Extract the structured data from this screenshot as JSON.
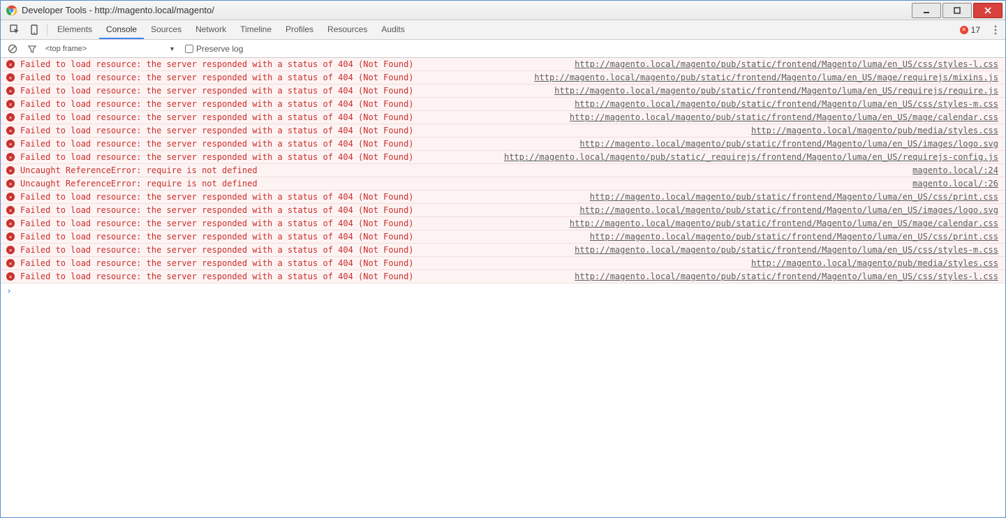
{
  "window": {
    "title": "Developer Tools - http://magento.local/magento/"
  },
  "tabs": {
    "items": [
      {
        "label": "Elements",
        "active": false
      },
      {
        "label": "Console",
        "active": true
      },
      {
        "label": "Sources",
        "active": false
      },
      {
        "label": "Network",
        "active": false
      },
      {
        "label": "Timeline",
        "active": false
      },
      {
        "label": "Profiles",
        "active": false
      },
      {
        "label": "Resources",
        "active": false
      },
      {
        "label": "Audits",
        "active": false
      }
    ],
    "error_count": "17"
  },
  "console_toolbar": {
    "frame_selector": "<top frame>",
    "preserve_log_label": "Preserve log",
    "preserve_log_checked": false
  },
  "messages": [
    {
      "text": "Failed to load resource: the server responded with a status of 404 (Not Found)",
      "link": "http://magento.local/magento/pub/static/frontend/Magento/luma/en_US/css/styles-l.css"
    },
    {
      "text": "Failed to load resource: the server responded with a status of 404 (Not Found)",
      "link": "http://magento.local/magento/pub/static/frontend/Magento/luma/en_US/mage/requirejs/mixins.js"
    },
    {
      "text": "Failed to load resource: the server responded with a status of 404 (Not Found)",
      "link": "http://magento.local/magento/pub/static/frontend/Magento/luma/en_US/requirejs/require.js"
    },
    {
      "text": "Failed to load resource: the server responded with a status of 404 (Not Found)",
      "link": "http://magento.local/magento/pub/static/frontend/Magento/luma/en_US/css/styles-m.css"
    },
    {
      "text": "Failed to load resource: the server responded with a status of 404 (Not Found)",
      "link": "http://magento.local/magento/pub/static/frontend/Magento/luma/en_US/mage/calendar.css"
    },
    {
      "text": "Failed to load resource: the server responded with a status of 404 (Not Found)",
      "link": "http://magento.local/magento/pub/media/styles.css"
    },
    {
      "text": "Failed to load resource: the server responded with a status of 404 (Not Found)",
      "link": "http://magento.local/magento/pub/static/frontend/Magento/luma/en_US/images/logo.svg"
    },
    {
      "text": "Failed to load resource: the server responded with a status of 404 (Not Found)",
      "link": "http://magento.local/magento/pub/static/_requirejs/frontend/Magento/luma/en_US/requirejs-config.js"
    },
    {
      "text": "Uncaught ReferenceError: require is not defined",
      "link": "magento.local/:24"
    },
    {
      "text": "Uncaught ReferenceError: require is not defined",
      "link": "magento.local/:26"
    },
    {
      "text": "Failed to load resource: the server responded with a status of 404 (Not Found)",
      "link": "http://magento.local/magento/pub/static/frontend/Magento/luma/en_US/css/print.css"
    },
    {
      "text": "Failed to load resource: the server responded with a status of 404 (Not Found)",
      "link": "http://magento.local/magento/pub/static/frontend/Magento/luma/en_US/images/logo.svg"
    },
    {
      "text": "Failed to load resource: the server responded with a status of 404 (Not Found)",
      "link": "http://magento.local/magento/pub/static/frontend/Magento/luma/en_US/mage/calendar.css"
    },
    {
      "text": "Failed to load resource: the server responded with a status of 404 (Not Found)",
      "link": "http://magento.local/magento/pub/static/frontend/Magento/luma/en_US/css/print.css"
    },
    {
      "text": "Failed to load resource: the server responded with a status of 404 (Not Found)",
      "link": "http://magento.local/magento/pub/static/frontend/Magento/luma/en_US/css/styles-m.css"
    },
    {
      "text": "Failed to load resource: the server responded with a status of 404 (Not Found)",
      "link": "http://magento.local/magento/pub/media/styles.css"
    },
    {
      "text": "Failed to load resource: the server responded with a status of 404 (Not Found)",
      "link": "http://magento.local/magento/pub/static/frontend/Magento/luma/en_US/css/styles-l.css"
    }
  ],
  "prompt": "›"
}
